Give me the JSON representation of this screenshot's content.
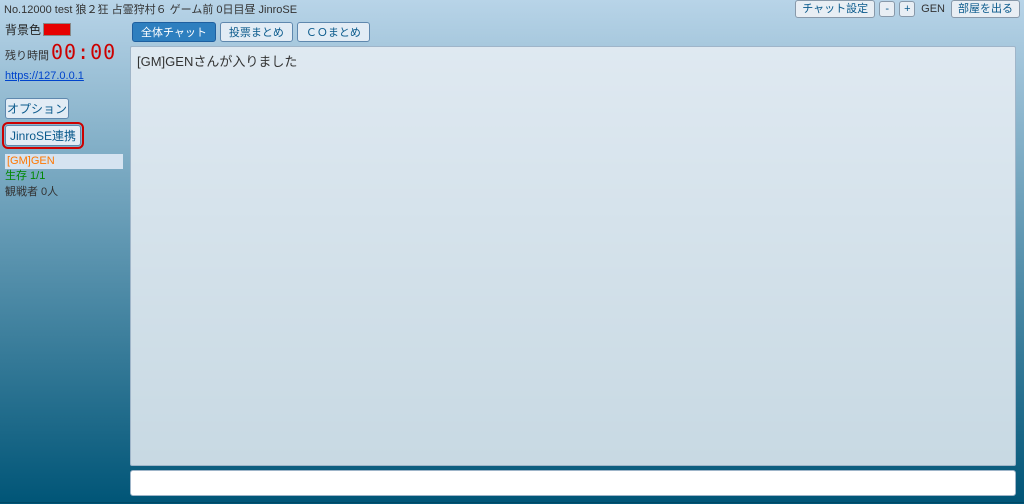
{
  "header": {
    "title": "No.12000 test 狼２狂 占霊狩村６  ゲーム前 0日目昼 JinroSE",
    "chat_settings": "チャット設定",
    "minus": "-",
    "plus": "+",
    "user": "GEN",
    "leave": "部屋を出る"
  },
  "sidebar": {
    "bg_label": "背景色",
    "bg_color": "#e60000",
    "time_label": "残り時間",
    "time_value": "00:00",
    "link_url": "https://127.0.0.1",
    "option_btn": "オプション",
    "jinrose_btn": "JinroSE連携",
    "gm_line": "[GM]GEN",
    "alive_line": "生存 1/1",
    "spectator_line": "観戦者 0人"
  },
  "tabs": [
    {
      "label": "全体チャット",
      "active": true
    },
    {
      "label": "投票まとめ",
      "active": false
    },
    {
      "label": "ＣＯまとめ",
      "active": false
    }
  ],
  "chat": {
    "lines": [
      "[GM]GENさんが入りました"
    ],
    "input_placeholder": ""
  }
}
